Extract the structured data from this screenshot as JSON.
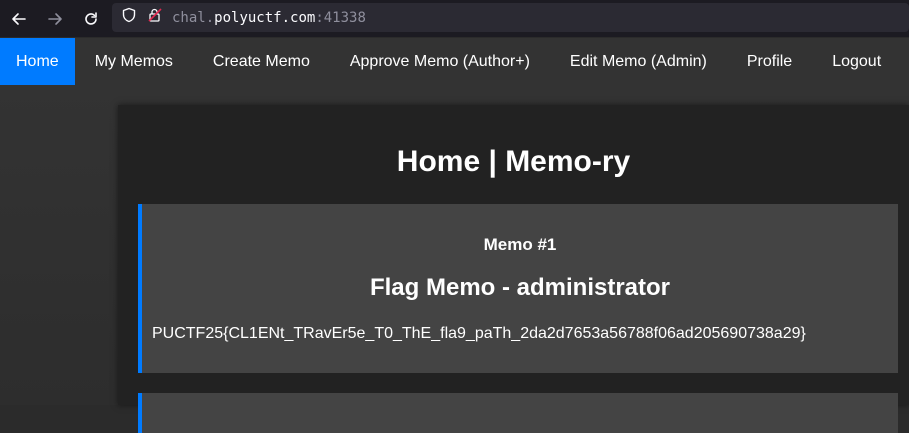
{
  "browser": {
    "url_prefix": "chal.",
    "url_host": "polyuctf.com",
    "url_port": ":41338"
  },
  "nav": {
    "items": [
      {
        "label": "Home",
        "active": true
      },
      {
        "label": "My Memos"
      },
      {
        "label": "Create Memo"
      },
      {
        "label": "Approve Memo (Author+)"
      },
      {
        "label": "Edit Memo (Admin)"
      },
      {
        "label": "Profile"
      },
      {
        "label": "Logout"
      }
    ]
  },
  "main": {
    "title": "Home | Memo-ry",
    "memos": [
      {
        "number": "Memo #1",
        "title": "Flag Memo - administrator",
        "content": "PUCTF25{CL1ENt_TRavEr5e_T0_ThE_fla9_paTh_2da2d7653a56788f06ad205690738a29}"
      }
    ]
  },
  "colors": {
    "accent": "#007bff",
    "navbar": "#333333",
    "card": "#444444",
    "container": "#222222"
  }
}
